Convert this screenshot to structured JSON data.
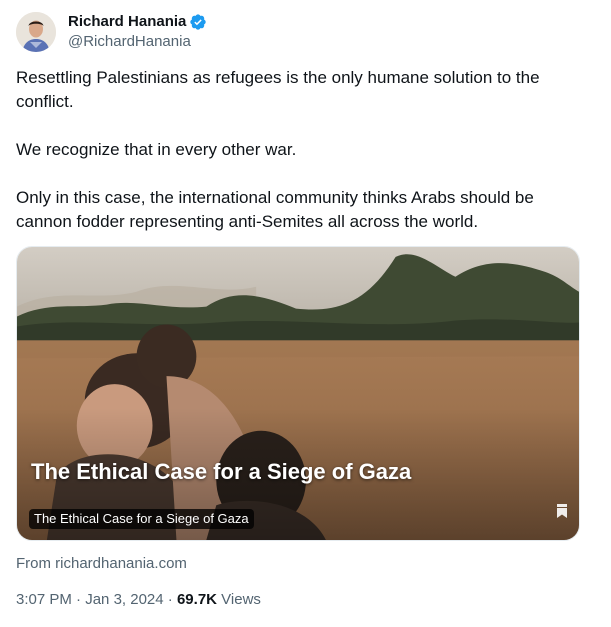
{
  "author": {
    "display_name": "Richard Hanania",
    "handle": "@RichardHanania",
    "verified_color": "#1d9bf0"
  },
  "tweet": {
    "paragraphs": [
      "Resettling Palestinians as refugees is the only humane solution to the conflict.",
      "We recognize that in every other war.",
      "Only in this case, the international community thinks Arabs should be cannon fodder representing anti-Semites all across the world."
    ]
  },
  "card": {
    "overlay_title": "The Ethical Case for a Siege of Gaza",
    "caption": "The Ethical Case for a Siege of Gaza",
    "icon": "bookmark-icon"
  },
  "source": {
    "from_text": "From richardhanania.com"
  },
  "meta": {
    "time": "3:07 PM",
    "separator": "·",
    "date": "Jan 3, 2024",
    "views_count": "69.7K",
    "views_label": "Views"
  }
}
